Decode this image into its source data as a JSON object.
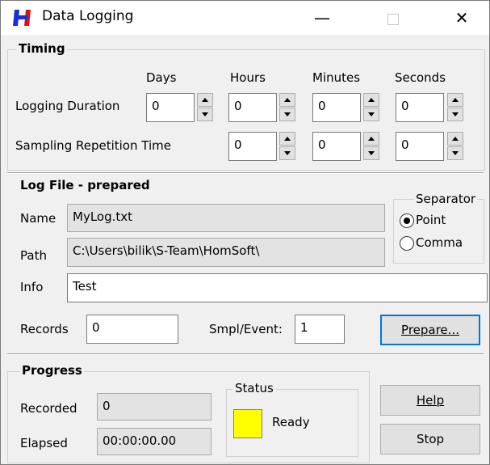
{
  "window": {
    "title": "Data Logging",
    "minimize": "—",
    "close": "✕"
  },
  "timing": {
    "group_title": "Timing",
    "headers": [
      "Days",
      "Hours",
      "Minutes",
      "Seconds"
    ],
    "rows": [
      {
        "label": "Logging Duration",
        "values": [
          "0",
          "0",
          "0",
          "0"
        ]
      },
      {
        "label": "Sampling Repetition Time",
        "values": [
          "0",
          "0",
          "0"
        ]
      }
    ]
  },
  "log_file": {
    "group_title": "Log File - prepared",
    "name_label": "Name",
    "name_value": "MyLog.txt",
    "path_label": "Path",
    "path_value": "C:\\Users\\bilik\\S-Team\\HomSoft\\",
    "info_label": "Info",
    "info_value": "Test",
    "records_label": "Records",
    "records_value": "0",
    "smpl_label": "Smpl/Event:",
    "smpl_value": "1",
    "prepare_button": "Prepare..."
  },
  "separator": {
    "group_title": "Separator",
    "options": [
      {
        "label": "Point",
        "checked": true
      },
      {
        "label": "Comma",
        "checked": false
      }
    ]
  },
  "progress": {
    "group_title": "Progress",
    "recorded_label": "Recorded",
    "recorded_value": "0",
    "elapsed_label": "Elapsed",
    "elapsed_value": "00:00:00.00"
  },
  "status": {
    "group_title": "Status",
    "text": "Ready",
    "light_color": "#ffff00"
  },
  "buttons": {
    "help": "Help",
    "stop": "Stop"
  },
  "colors": {
    "accent": "#0078d7",
    "app_icon_blue": "#1a2fd6",
    "app_icon_red": "#e01010"
  }
}
